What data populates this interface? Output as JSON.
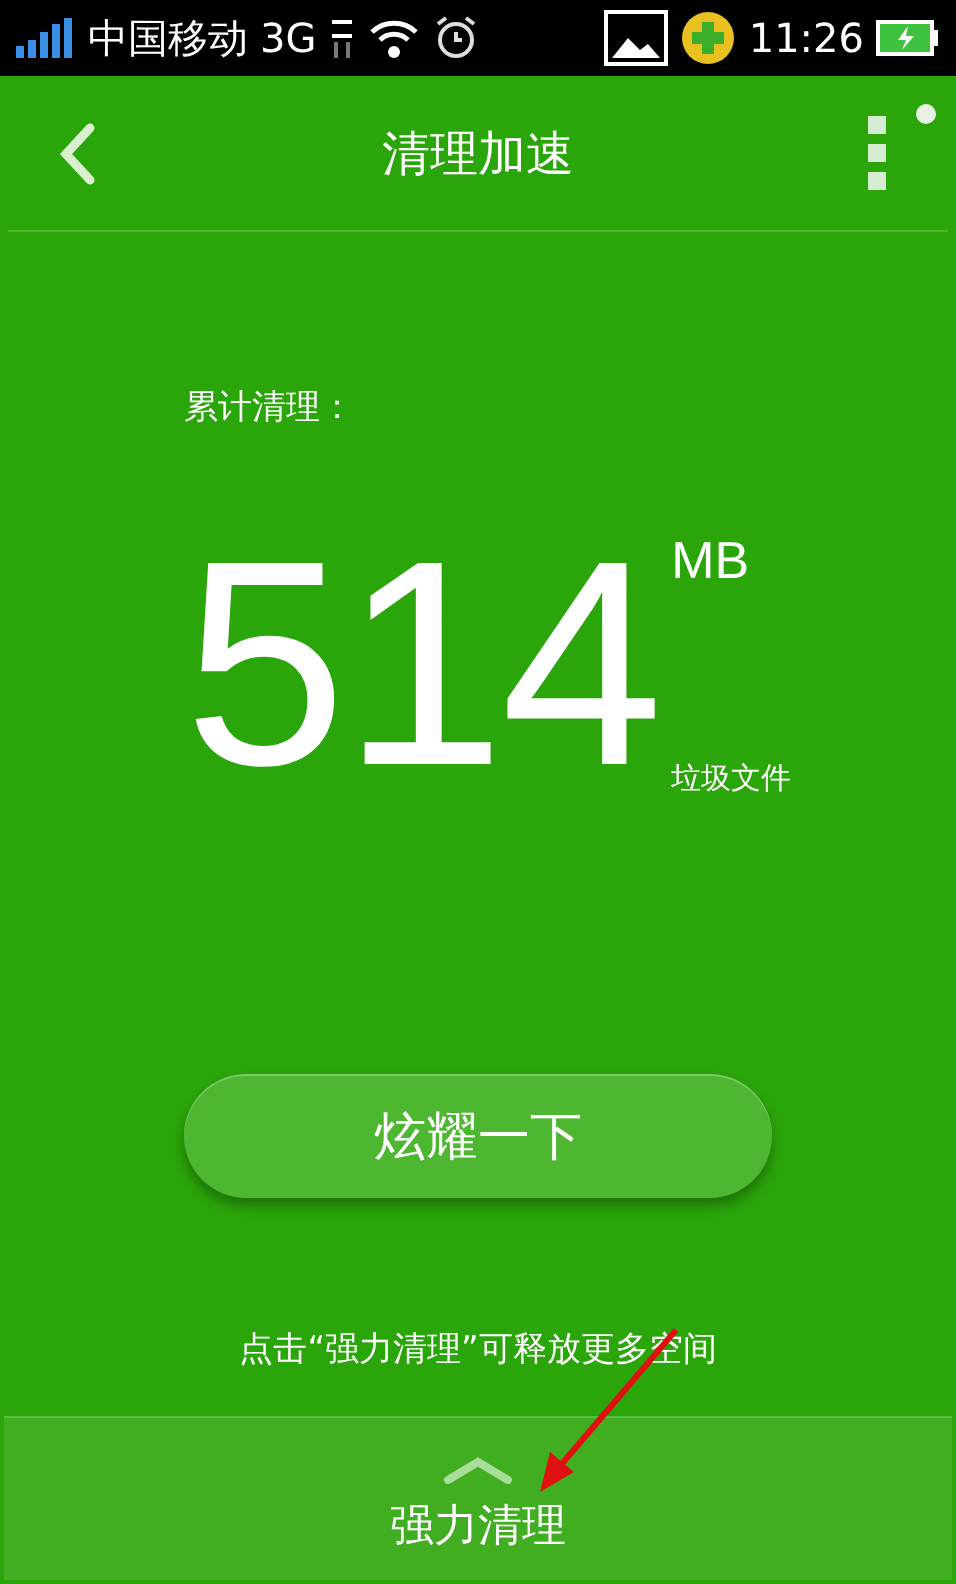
{
  "status_bar": {
    "carrier": "中国移动",
    "network": "3G",
    "time": "11:26"
  },
  "header": {
    "title": "清理加速"
  },
  "summary": {
    "label": "累计清理：",
    "amount": "514",
    "unit": "MB",
    "caption": "垃圾文件"
  },
  "action_button": {
    "label": "炫耀一下"
  },
  "hint": "点击“强力清理”可释放更多空间",
  "bottom_panel": {
    "label": "强力清理"
  }
}
